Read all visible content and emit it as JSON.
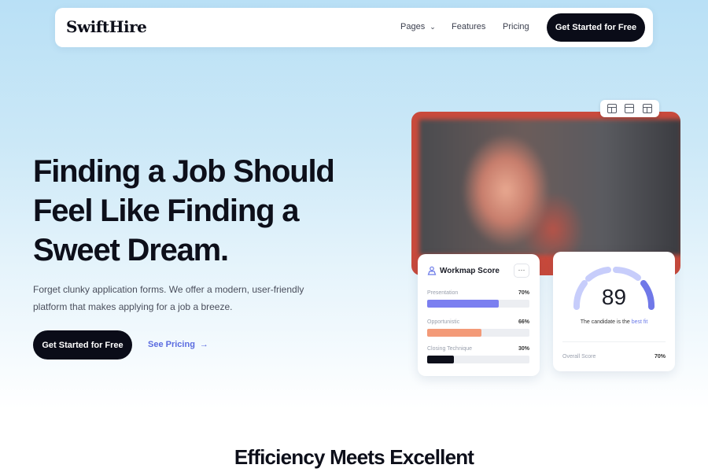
{
  "nav": {
    "logo": "SwiftHire",
    "links": {
      "pages": "Pages",
      "features": "Features",
      "pricing": "Pricing"
    },
    "cta": "Get Started for Free"
  },
  "hero": {
    "title_lines": [
      "Finding a Job Should",
      "Feel Like Finding a",
      "Sweet Dream."
    ],
    "subtitle": "Forget clunky application forms. We offer a modern, user-friendly platform that makes applying for a job a breeze.",
    "cta": "Get Started for Free",
    "secondary": "See Pricing"
  },
  "workmap": {
    "title": "Workmap Score",
    "more": "···",
    "metrics": [
      {
        "label": "Presentation",
        "value": "70%",
        "fraction": 0.7,
        "color": "#7b7ff0"
      },
      {
        "label": "Opportunistic",
        "value": "66%",
        "fraction": 0.53,
        "color": "#f39a78"
      },
      {
        "label": "Closing Technique",
        "value": "30%",
        "fraction": 0.26,
        "color": "#0d0f1a"
      }
    ]
  },
  "score": {
    "value": "89",
    "text_prefix": "The candidate is the",
    "text_highlight": "best fit",
    "overall_label": "Overall Score",
    "overall_value": "70%"
  },
  "section": {
    "title": "Efficiency Meets Excellent"
  },
  "colors": {
    "accent": "#5b6ce0",
    "dark": "#0a0c18"
  }
}
